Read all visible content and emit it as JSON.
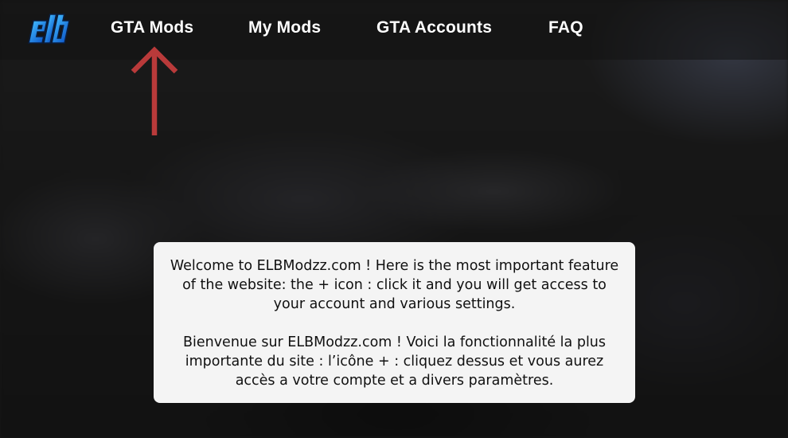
{
  "nav": {
    "items": [
      {
        "label": "GTA Mods"
      },
      {
        "label": "My Mods"
      },
      {
        "label": "GTA Accounts"
      },
      {
        "label": "FAQ"
      }
    ]
  },
  "notice": {
    "english": "Welcome to ELBModzz.com ! Here is the most important feature of the website: the + icon : click it and you will get access to your account and various settings.",
    "french": "Bienvenue sur ELBModzz.com ! Voici la fonctionnalité la plus importante du site : l’icône + : cliquez dessus et vous aurez accès a votre compte et a divers paramètres."
  },
  "colors": {
    "background": "#171717",
    "arrow": "#b93a3a",
    "logo_blue": "#1e8fe6",
    "notice_bg": "#f4f4f4"
  },
  "icons": {
    "logo": "elb-logo",
    "arrow": "arrow-up-icon"
  }
}
